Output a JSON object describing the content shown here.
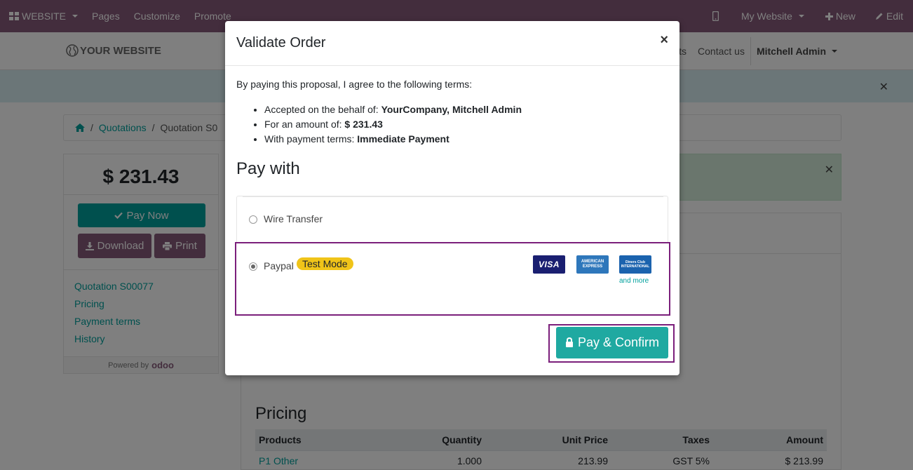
{
  "topbar": {
    "website_label": "WEBSITE",
    "pages_label": "Pages",
    "customize_label": "Customize",
    "promote_label": "Promote",
    "my_website_label": "My Website",
    "new_label": "New",
    "edit_label": "Edit"
  },
  "navbar": {
    "brand": "YOUR WEBSITE",
    "links_partial": "ts",
    "contact_label": "Contact us",
    "user_label": "Mitchell Admin"
  },
  "breadcrumb": {
    "sep": "/",
    "quotations": "Quotations",
    "current": "Quotation S0"
  },
  "sidebar": {
    "amount": "$ 231.43",
    "pay_now_label": "Pay Now",
    "download_label": "Download",
    "print_label": "Print",
    "nav": [
      {
        "label": "Quotation S00077"
      },
      {
        "label": "Pricing"
      },
      {
        "label": "Payment terms"
      },
      {
        "label": "History"
      }
    ],
    "powered_by": "Powered by",
    "odoo": "odoo"
  },
  "main": {
    "pricing_title": "Pricing",
    "table": {
      "headers": [
        "Products",
        "Quantity",
        "Unit Price",
        "Taxes",
        "Amount"
      ],
      "rows": [
        {
          "product": "P1 Other",
          "quantity": "1.000",
          "unit_price": "213.99",
          "taxes": "GST 5%",
          "amount": "$ 213.99"
        }
      ]
    }
  },
  "modal": {
    "title": "Validate Order",
    "close": "×",
    "terms_intro": "By paying this proposal, I agree to the following terms:",
    "terms": [
      {
        "prefix": "Accepted on the behalf of: ",
        "value": "YourCompany, Mitchell Admin"
      },
      {
        "prefix": "For an amount of: ",
        "value": "$ 231.43"
      },
      {
        "prefix": "With payment terms: ",
        "value": "Immediate Payment"
      }
    ],
    "pay_with": "Pay with",
    "acquirers": [
      {
        "label": "Wire Transfer",
        "selected": false
      },
      {
        "label": "Paypal",
        "selected": true,
        "badge": "Test Mode"
      }
    ],
    "card_icons": [
      "visa",
      "amex",
      "diners"
    ],
    "visa_text": "VISA",
    "amex_text": "AMERICAN EXPRESS",
    "diners_text": "Diners Club INTERNATIONAL",
    "and_more": "and more",
    "confirm_label": "Pay & Confirm"
  },
  "colors": {
    "topbar": "#875a7b",
    "accent": "#00a09d",
    "highlight_border": "#7b1f7b",
    "badge": "#f0c419"
  }
}
